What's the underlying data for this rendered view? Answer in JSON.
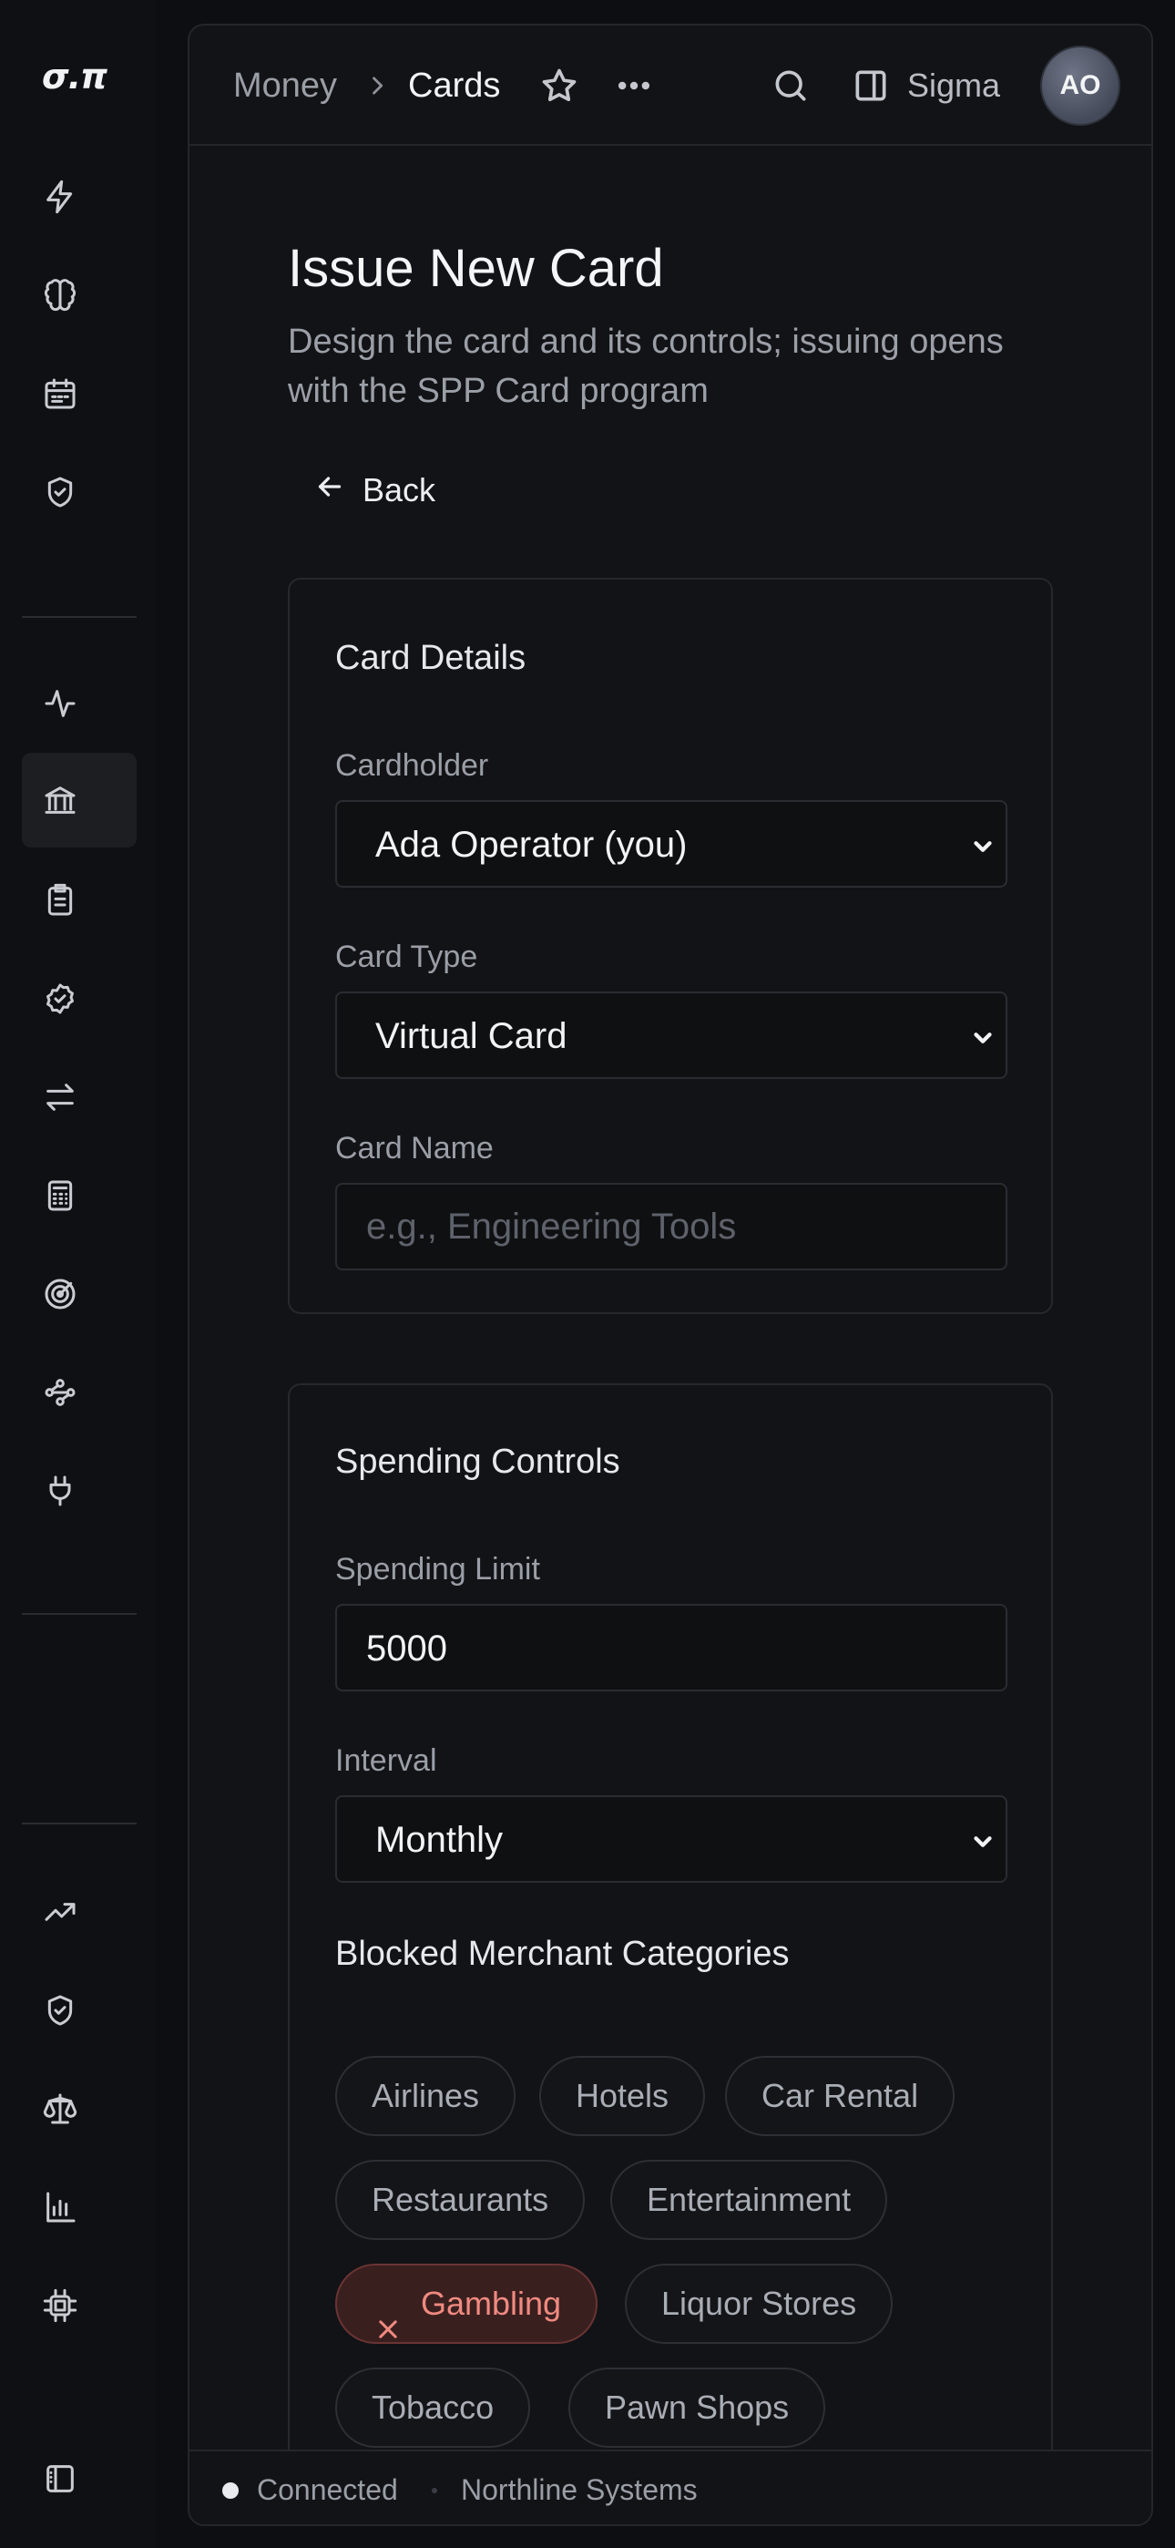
{
  "rail": {
    "logo": "σ.π",
    "items": [
      {
        "icon": "bolt-icon"
      },
      {
        "icon": "brain-icon"
      },
      {
        "icon": "calendar-icon"
      },
      {
        "icon": "shield-check-icon"
      },
      {
        "icon": "activity-icon"
      },
      {
        "icon": "bank-icon",
        "active": true
      },
      {
        "icon": "clipboard-icon"
      },
      {
        "icon": "badge-check-icon"
      },
      {
        "icon": "transfer-arrows-icon"
      },
      {
        "icon": "calculator-icon"
      },
      {
        "icon": "target-icon"
      },
      {
        "icon": "workflow-icon"
      },
      {
        "icon": "plug-icon"
      },
      {
        "icon": "trending-up-icon"
      },
      {
        "icon": "shield-check-icon"
      },
      {
        "icon": "scale-icon"
      },
      {
        "icon": "bar-chart-icon"
      },
      {
        "icon": "chip-icon"
      },
      {
        "icon": "sidebar-toggle-icon"
      }
    ]
  },
  "topbar": {
    "crumb_money": "Money",
    "crumb_cards": "Cards",
    "workspace": "Sigma",
    "avatar": "AO"
  },
  "page": {
    "title": "Issue New Card",
    "subtitle": "Design the card and its controls; issuing opens with the SPP Card program",
    "back": "Back"
  },
  "card_details": {
    "title": "Card Details",
    "cardholder_label": "Cardholder",
    "cardholder_value": "Ada Operator (you)",
    "type_label": "Card Type",
    "type_value": "Virtual Card",
    "name_label": "Card Name",
    "name_placeholder": "e.g., Engineering Tools"
  },
  "spending": {
    "title": "Spending Controls",
    "limit_label": "Spending Limit",
    "limit_value": "5000",
    "interval_label": "Interval",
    "interval_value": "Monthly",
    "blocked_label": "Blocked Merchant Categories",
    "categories": [
      {
        "name": "Airlines",
        "blocked": false
      },
      {
        "name": "Hotels",
        "blocked": false
      },
      {
        "name": "Car Rental",
        "blocked": false
      },
      {
        "name": "Restaurants",
        "blocked": false
      },
      {
        "name": "Entertainment",
        "blocked": false
      },
      {
        "name": "Gambling",
        "blocked": true
      },
      {
        "name": "Liquor Stores",
        "blocked": false
      },
      {
        "name": "Tobacco",
        "blocked": false
      },
      {
        "name": "Pawn Shops",
        "blocked": false
      }
    ]
  },
  "status": {
    "connection": "Connected",
    "org": "Northline Systems"
  },
  "colors": {
    "background": "#0d0e11",
    "panel": "#121316",
    "blocked_chip_bg": "#3a1f1f",
    "blocked_chip_text": "#f08a80"
  }
}
